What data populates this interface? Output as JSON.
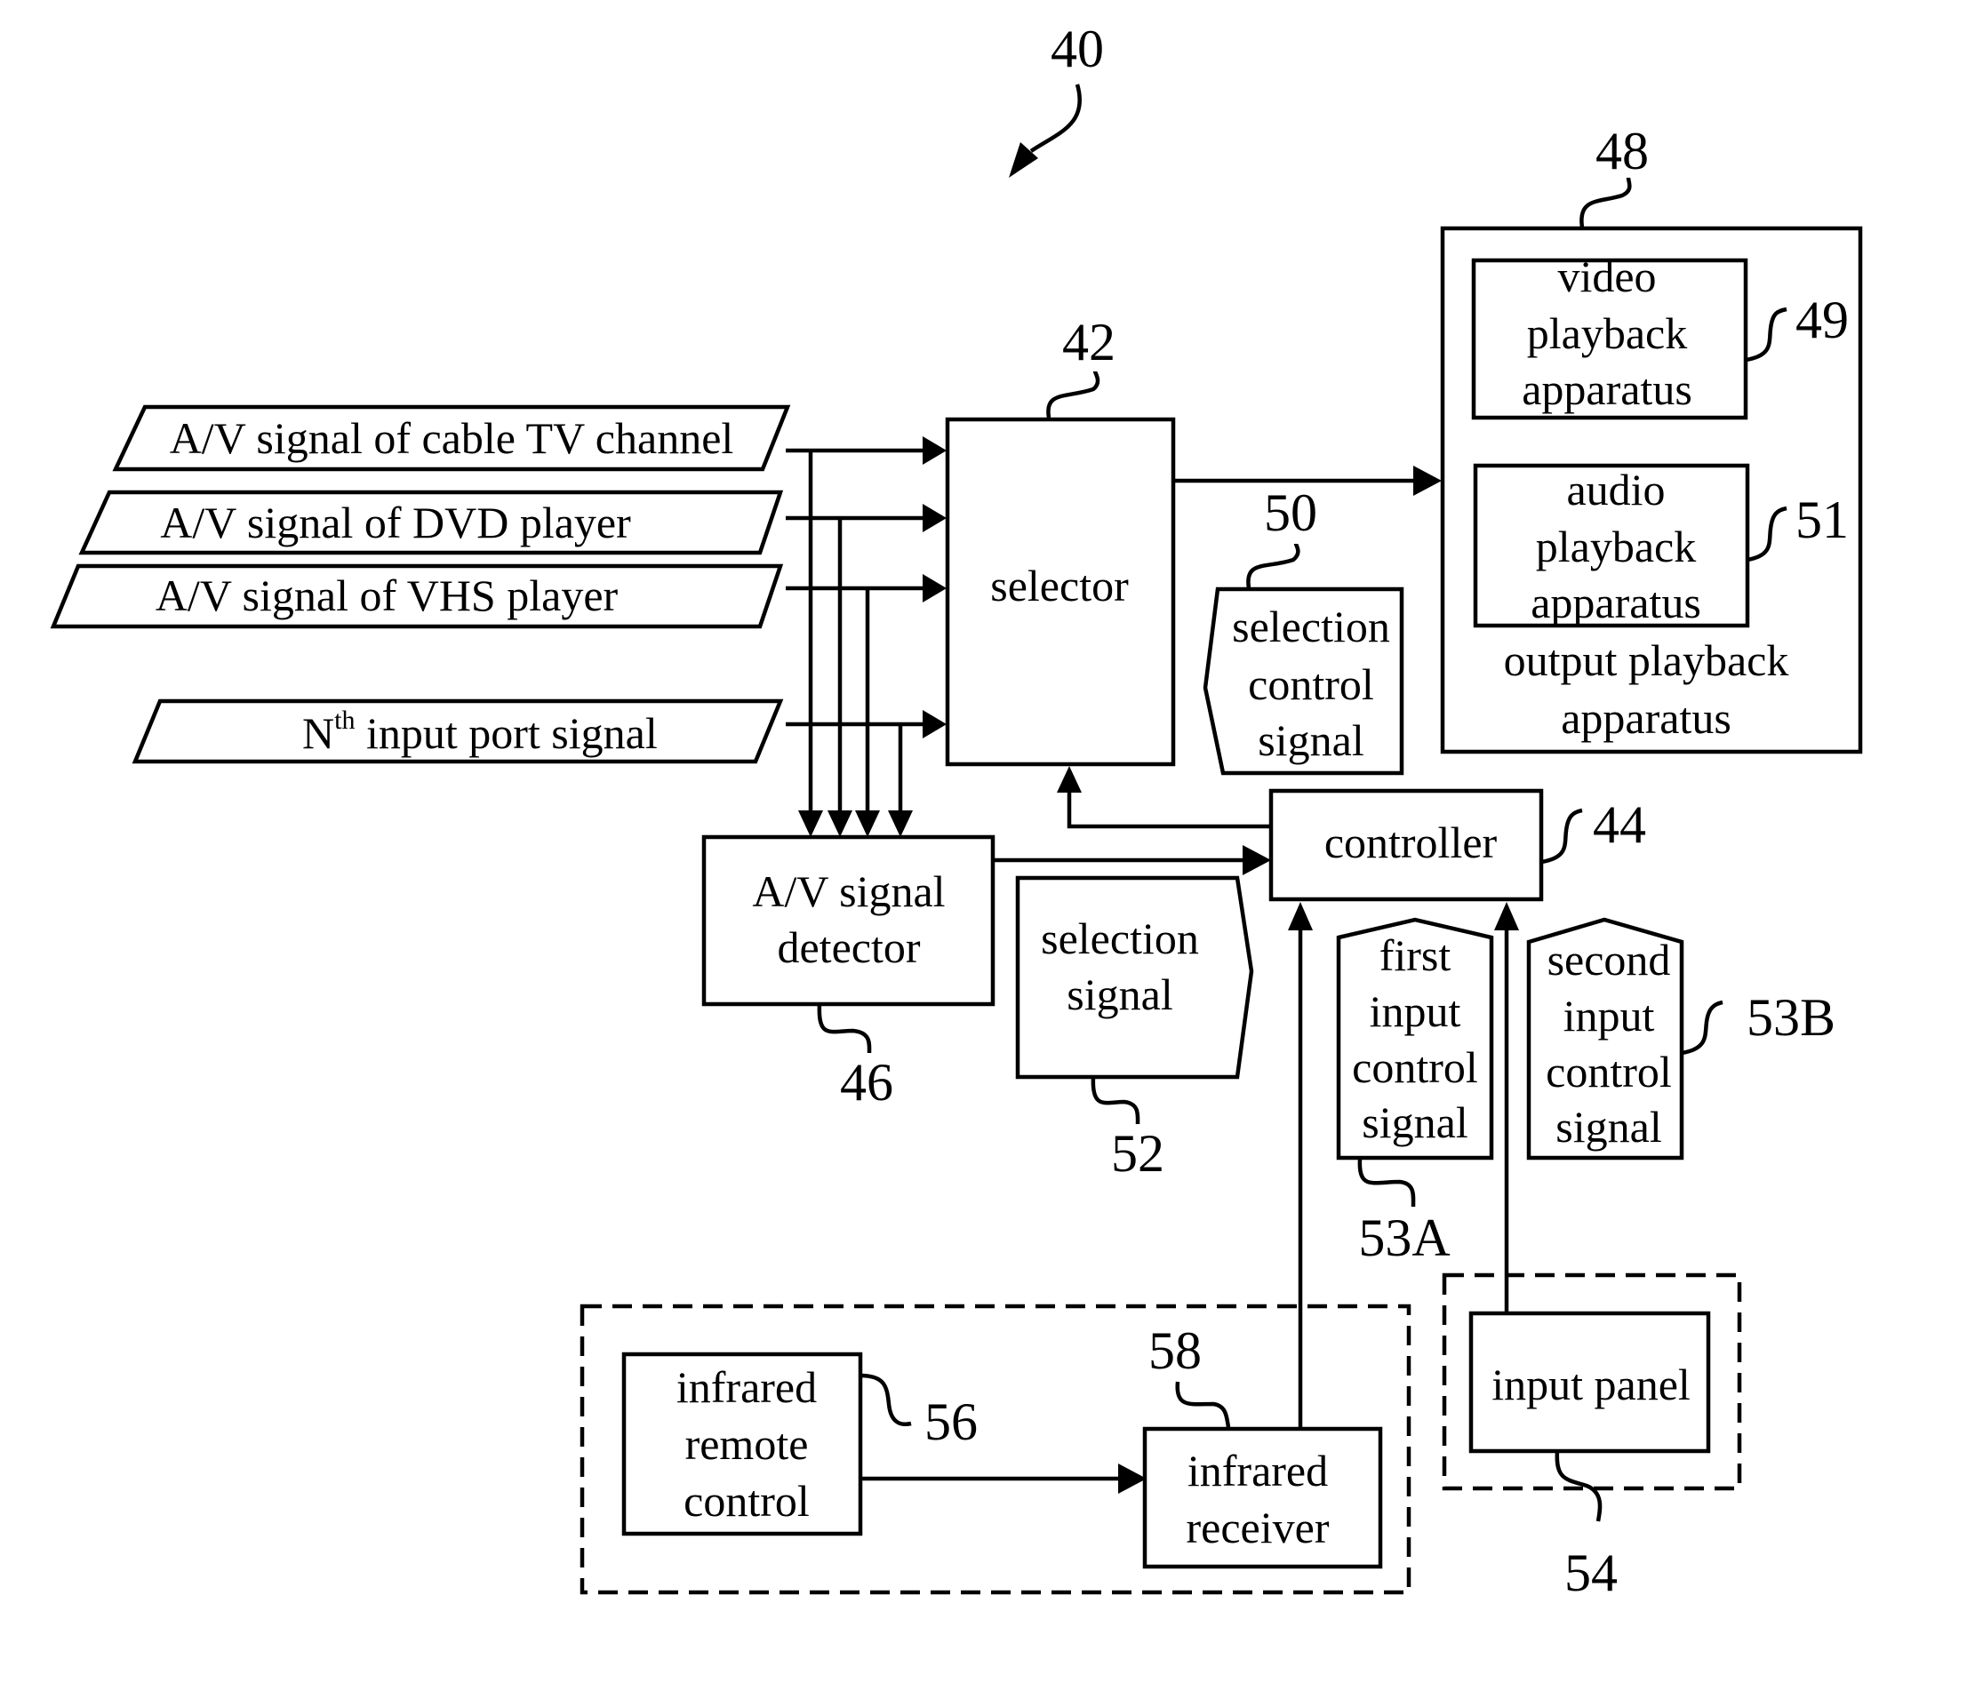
{
  "figure_number": "40",
  "inputs": [
    {
      "label": "A/V signal of cable TV channel"
    },
    {
      "label": "A/V signal of DVD player"
    },
    {
      "label": "A/V signal of VHS player"
    },
    {
      "label_main": "N",
      "label_sup": "th",
      "label_rest": " input port signal"
    }
  ],
  "selector": {
    "label": "selector",
    "ref": "42"
  },
  "output": {
    "ref": "48",
    "label_lines": [
      "output playback",
      "apparatus"
    ],
    "video": {
      "lines": [
        "video",
        "playback",
        "apparatus"
      ],
      "ref": "49"
    },
    "audio": {
      "lines": [
        "audio",
        "playback",
        "apparatus"
      ],
      "ref": "51"
    }
  },
  "selection_control_signal": {
    "lines": [
      "selection",
      "control",
      "signal"
    ],
    "ref": "50"
  },
  "controller": {
    "label": "controller",
    "ref": "44"
  },
  "detector": {
    "lines": [
      "A/V signal",
      "detector"
    ],
    "ref": "46"
  },
  "selection_signal": {
    "lines": [
      "selection",
      "signal"
    ],
    "ref": "52"
  },
  "first_input": {
    "lines": [
      "first",
      "input",
      "control",
      "signal"
    ],
    "ref": "53A"
  },
  "second_input": {
    "lines": [
      "second",
      "input",
      "control",
      "signal"
    ],
    "ref": "53B"
  },
  "remote": {
    "lines": [
      "infrared",
      "remote",
      "control"
    ],
    "ref": "56"
  },
  "receiver": {
    "lines": [
      "infrared",
      "receiver"
    ],
    "ref": "58"
  },
  "panel": {
    "label": "input panel",
    "ref": "54"
  }
}
